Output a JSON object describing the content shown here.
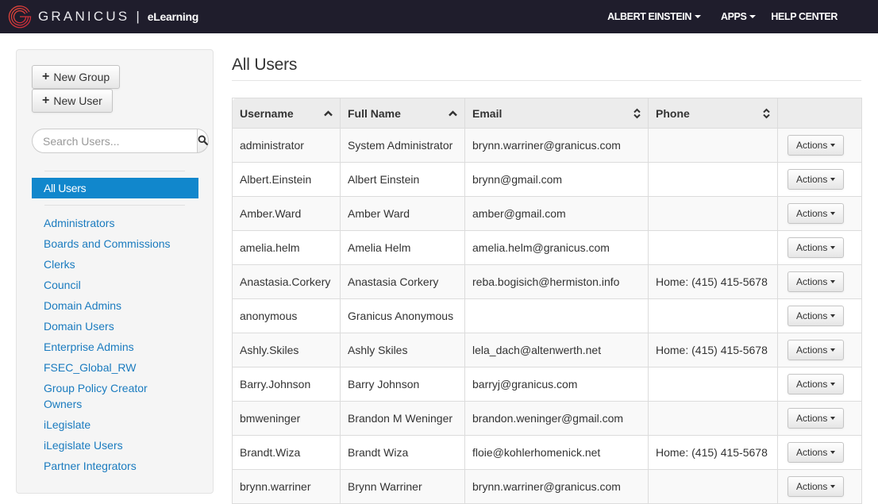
{
  "topnav": {
    "brand": "GRANICUS",
    "separator": "|",
    "product": "eLearning",
    "user_menu": "ALBERT EINSTEIN",
    "apps_menu": "APPS",
    "help_center": "HELP CENTER",
    "logo_color": "#d9363e"
  },
  "sidebar": {
    "new_group_label": "New Group",
    "new_user_label": "New User",
    "search_placeholder": "Search Users...",
    "active_item": "All Users",
    "active_color": "#1187cc",
    "groups": [
      "Administrators",
      "Boards and Commissions",
      "Clerks",
      "Council",
      "Domain Admins",
      "Domain Users",
      "Enterprise Admins",
      "FSEC_Global_RW",
      "Group Policy Creator Owners",
      "iLegislate",
      "iLegislate Users",
      "Partner Integrators"
    ],
    "link_color": "#1a7bbf"
  },
  "main": {
    "title": "All Users",
    "table": {
      "columns": [
        {
          "label": "Username",
          "sort": "asc"
        },
        {
          "label": "Full Name",
          "sort": "asc"
        },
        {
          "label": "Email",
          "sort": "both"
        },
        {
          "label": "Phone",
          "sort": "both"
        },
        {
          "label": "",
          "sort": "none"
        }
      ],
      "action_label": "Actions",
      "rows": [
        {
          "username": "administrator",
          "full_name": "System Administrator",
          "email": "brynn.warriner@granicus.com",
          "phone": ""
        },
        {
          "username": "Albert.Einstein",
          "full_name": "Albert Einstein",
          "email": "brynn@gmail.com",
          "phone": ""
        },
        {
          "username": "Amber.Ward",
          "full_name": "Amber Ward",
          "email": "amber@gmail.com",
          "phone": ""
        },
        {
          "username": "amelia.helm",
          "full_name": "Amelia Helm",
          "email": "amelia.helm@granicus.com",
          "phone": ""
        },
        {
          "username": "Anastasia.Corkery",
          "full_name": "Anastasia Corkery",
          "email": "reba.bogisich@hermiston.info",
          "phone": "Home: (415) 415-5678"
        },
        {
          "username": "anonymous",
          "full_name": "Granicus Anonymous",
          "email": "",
          "phone": ""
        },
        {
          "username": "Ashly.Skiles",
          "full_name": "Ashly Skiles",
          "email": "lela_dach@altenwerth.net",
          "phone": "Home: (415) 415-5678"
        },
        {
          "username": "Barry.Johnson",
          "full_name": "Barry Johnson",
          "email": "barryj@granicus.com",
          "phone": ""
        },
        {
          "username": "bmweninger",
          "full_name": "Brandon M Weninger",
          "email": "brandon.weninger@gmail.com",
          "phone": ""
        },
        {
          "username": "Brandt.Wiza",
          "full_name": "Brandt Wiza",
          "email": "floie@kohlerhomenick.net",
          "phone": "Home: (415) 415-5678"
        },
        {
          "username": "brynn.warriner",
          "full_name": "Brynn Warriner",
          "email": "brynn.warriner@granicus.com",
          "phone": ""
        }
      ]
    }
  }
}
